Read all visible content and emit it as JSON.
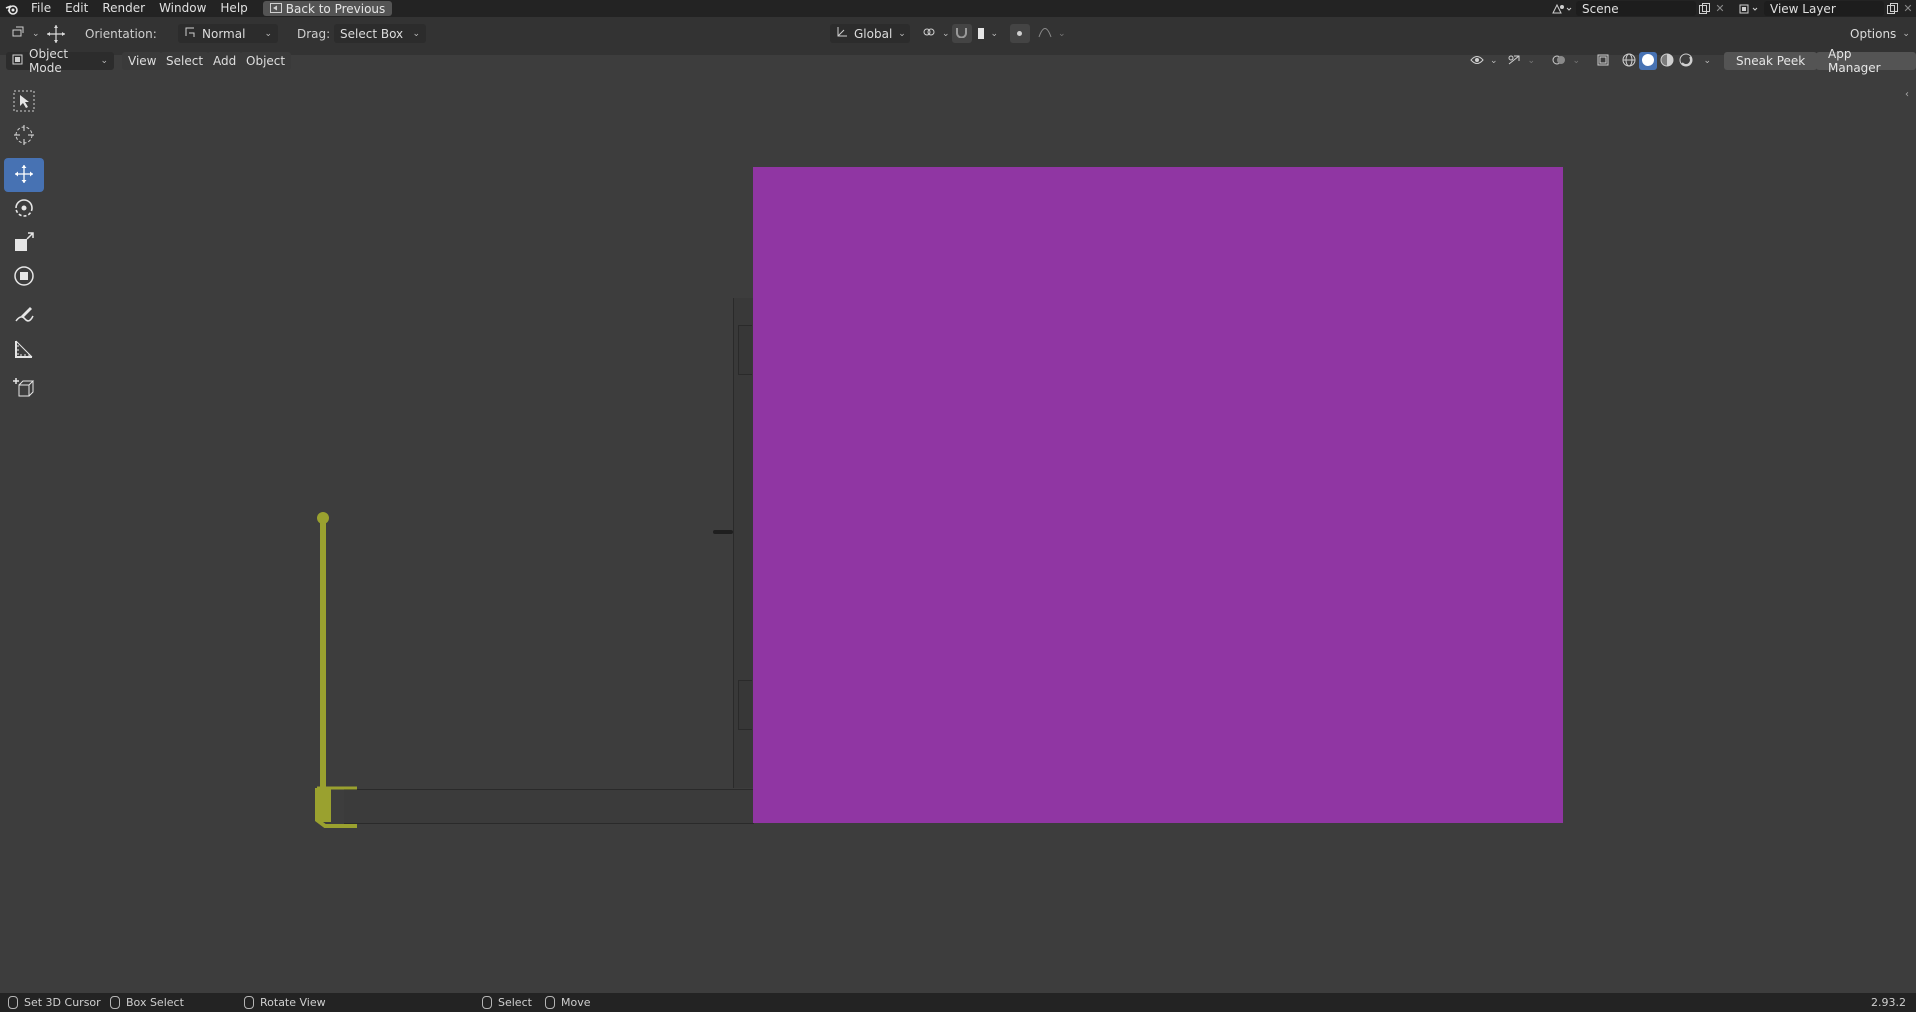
{
  "topbar": {
    "menus": [
      "File",
      "Edit",
      "Render",
      "Window",
      "Help"
    ],
    "back_button": "Back to Previous",
    "scene": "Scene",
    "view_layer": "View Layer"
  },
  "tool_header": {
    "orientation_label": "Orientation:",
    "orientation_value": "Normal",
    "drag_label": "Drag:",
    "drag_value": "Select Box",
    "transform_orientation": "Global",
    "options": "Options"
  },
  "viewport_header": {
    "mode": "Object Mode",
    "menus": [
      "View",
      "Select",
      "Add",
      "Object"
    ],
    "sneak_peek": "Sneak Peek",
    "app_manager": "App Manager"
  },
  "toolbar": {
    "tools": [
      "select-box",
      "cursor",
      "move",
      "rotate",
      "scale",
      "transform",
      "annotate",
      "measure",
      "add-cube"
    ],
    "active": "move"
  },
  "statusbar": {
    "items": [
      "Set 3D Cursor",
      "Box Select",
      "Rotate View",
      "Select",
      "Move"
    ],
    "version": "2.93.2"
  },
  "colors": {
    "accent": "#4772b3",
    "object_magenta": "#9036a3",
    "empty_yellow": "#9aa12f"
  }
}
